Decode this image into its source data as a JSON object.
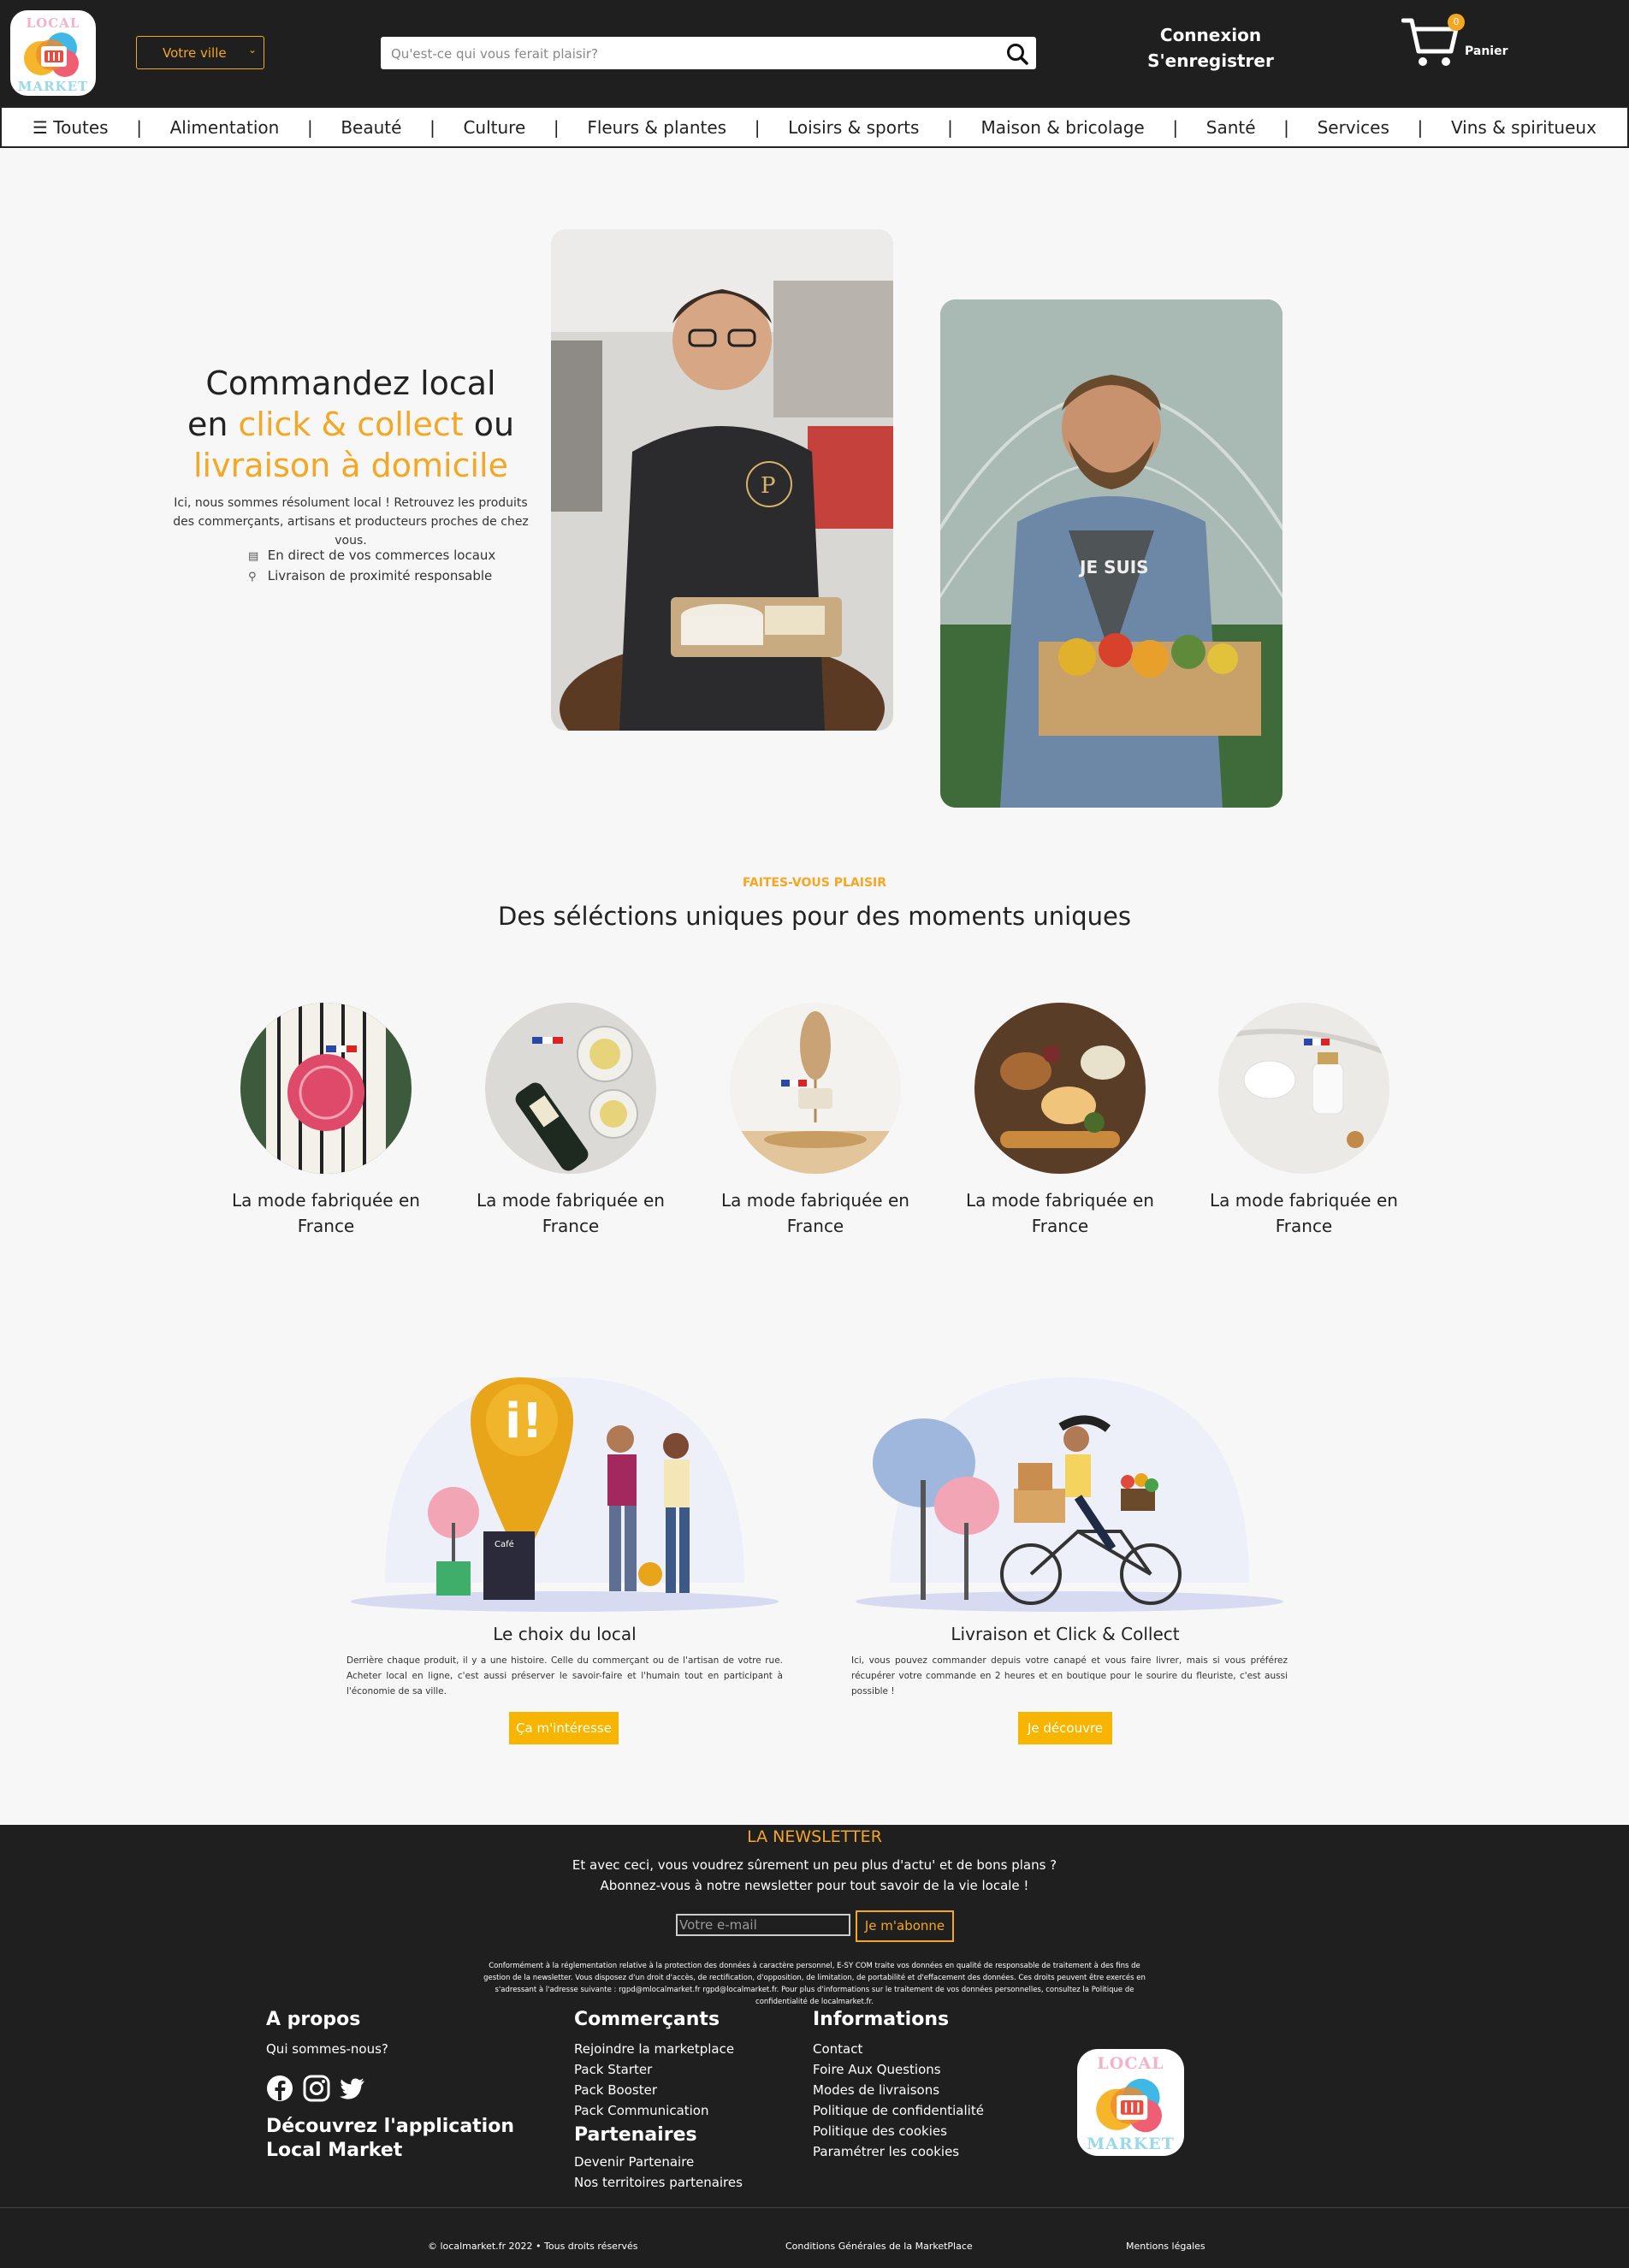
{
  "header": {
    "logo_top": "LOCAL",
    "logo_bottom": "MARKET",
    "city_select": "Votre ville",
    "search_placeholder": "Qu'est-ce qui vous ferait plaisir?",
    "login": "Connexion",
    "register": "S'enregistrer",
    "cart_count": "0",
    "cart_label": "Panier"
  },
  "categories": {
    "all": "☰ Toutes",
    "items": [
      "Alimentation",
      "Beauté",
      "Culture",
      "Fleurs & plantes",
      "Loisirs & sports",
      "Maison & bricolage",
      "Santé",
      "Services",
      "Vins & spiritueux"
    ],
    "separator": "|"
  },
  "hero": {
    "line1": "Commandez local",
    "line2_pre": "en ",
    "line2_hl": "click & collect",
    "line2_post": " ou",
    "line3_hl": "livraison à domicile",
    "subtitle": "Ici, nous sommes résolument local ! Retrouvez les produits des commerçants, artisans et producteurs proches de chez vous.",
    "bullet1": "En direct de vos commerces locaux",
    "bullet2": "Livraison de proximité responsable"
  },
  "selections": {
    "kicker": "FAITES-VOUS PLAISIR",
    "title": "Des séléctions uniques pour des moments uniques",
    "cards": [
      {
        "label": "La mode fabriquée en France"
      },
      {
        "label": "La mode fabriquée en France"
      },
      {
        "label": "La mode fabriquée en France"
      },
      {
        "label": "La mode fabriquée en France"
      },
      {
        "label": "La mode fabriquée en France"
      }
    ]
  },
  "features": {
    "choice_title": "Le choix du local",
    "choice_body": "Derrière chaque produit, il y a une histoire. Celle du commerçant ou de l'artisan de votre rue. Acheter local en ligne, c'est aussi préserver le savoir-faire et l'humain tout en participant à l'économie de sa ville.",
    "choice_button": "Ça m'intéresse",
    "delivery_title": "Livraison et Click & Collect",
    "delivery_body": "Ici, vous pouvez commander depuis votre canapé et vous faire livrer, mais si vous préférez récupérer votre commande en 2 heures et en boutique pour le sourire du fleuriste, c'est aussi possible !",
    "delivery_button": "Je découvre",
    "sign_title": "Café"
  },
  "newsletter": {
    "title": "LA NEWSLETTER",
    "line1": "Et avec ceci, vous voudrez sûrement un peu plus d'actu' et de bons plans ?",
    "line2": "Abonnez-vous à notre newsletter pour tout savoir de la vie locale !",
    "email_placeholder": "Votre e-mail",
    "subscribe": "Je m'abonne",
    "legal": "Conformément à la réglementation relative à la protection des données à caractère personnel, E-SY COM traite vos données en qualité de responsable de traitement à des fins de gestion de la newsletter. Vous disposez d'un droit d'accès, de rectification, d'opposition, de limitation, de portabilité et d'effacement des données. Ces droits peuvent être exercés en s'adressant à l'adresse suivante : rgpd@mlocalmarket.fr rgpd@localmarket.fr. Pour plus d'informations sur le traitement de vos données personnelles, consultez la Politique de confidentialité de localmarket.fr."
  },
  "footer": {
    "about_title": "A propos",
    "about_link": "Qui sommes-nous?",
    "app_title_1": "Découvrez l'application",
    "app_title_2": "Local Market",
    "merchants_title": "Commerçants",
    "merchants_links": [
      "Rejoindre la marketplace",
      "Pack Starter",
      "Pack Booster",
      "Pack Communication"
    ],
    "partners_title": "Partenaires",
    "partners_links": [
      "Devenir Partenaire",
      "Nos territoires partenaires"
    ],
    "info_title": "Informations",
    "info_links": [
      "Contact",
      "Foire Aux Questions",
      "Modes de livraisons",
      "Politique de confidentialité",
      "Politique des cookies",
      "Paramétrer les cookies"
    ],
    "copyright": "© localmarket.fr 2022 • Tous droits réservés",
    "cgv": "Conditions Générales de la MarketPlace",
    "mentions": "Mentions légales"
  },
  "colors": {
    "accent": "#f5a623",
    "dark": "#1f1f1f",
    "button_yellow": "#f7b500"
  },
  "icons": {
    "search": "search-icon",
    "cart": "cart-icon",
    "store": "store-icon",
    "bike": "bike-icon",
    "facebook": "facebook-icon",
    "instagram": "instagram-icon",
    "twitter": "twitter-icon"
  }
}
